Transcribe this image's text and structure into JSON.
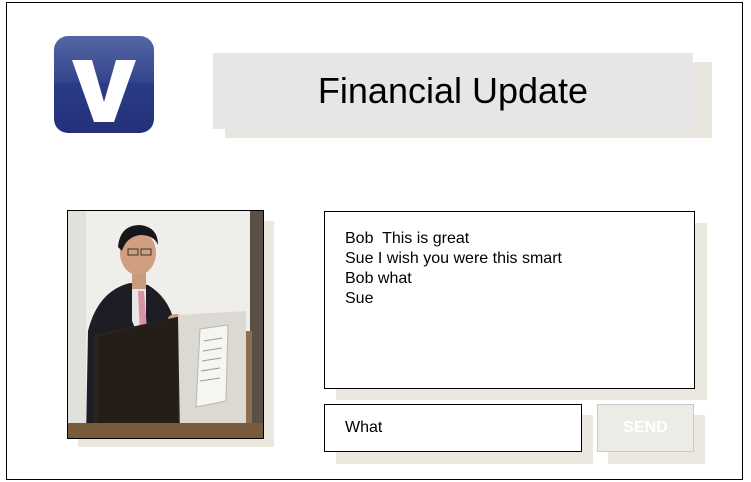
{
  "logo": {
    "letter": "V",
    "color": "#2a3b86"
  },
  "header": {
    "title": "Financial Update"
  },
  "photo": {
    "subject": "presenter at podium"
  },
  "chat": {
    "messages": [
      "Bob  This is great",
      "Sue I wish you were this smart",
      "Bob what",
      "Sue"
    ]
  },
  "composer": {
    "input_value": "What",
    "send_label": "SEND"
  }
}
